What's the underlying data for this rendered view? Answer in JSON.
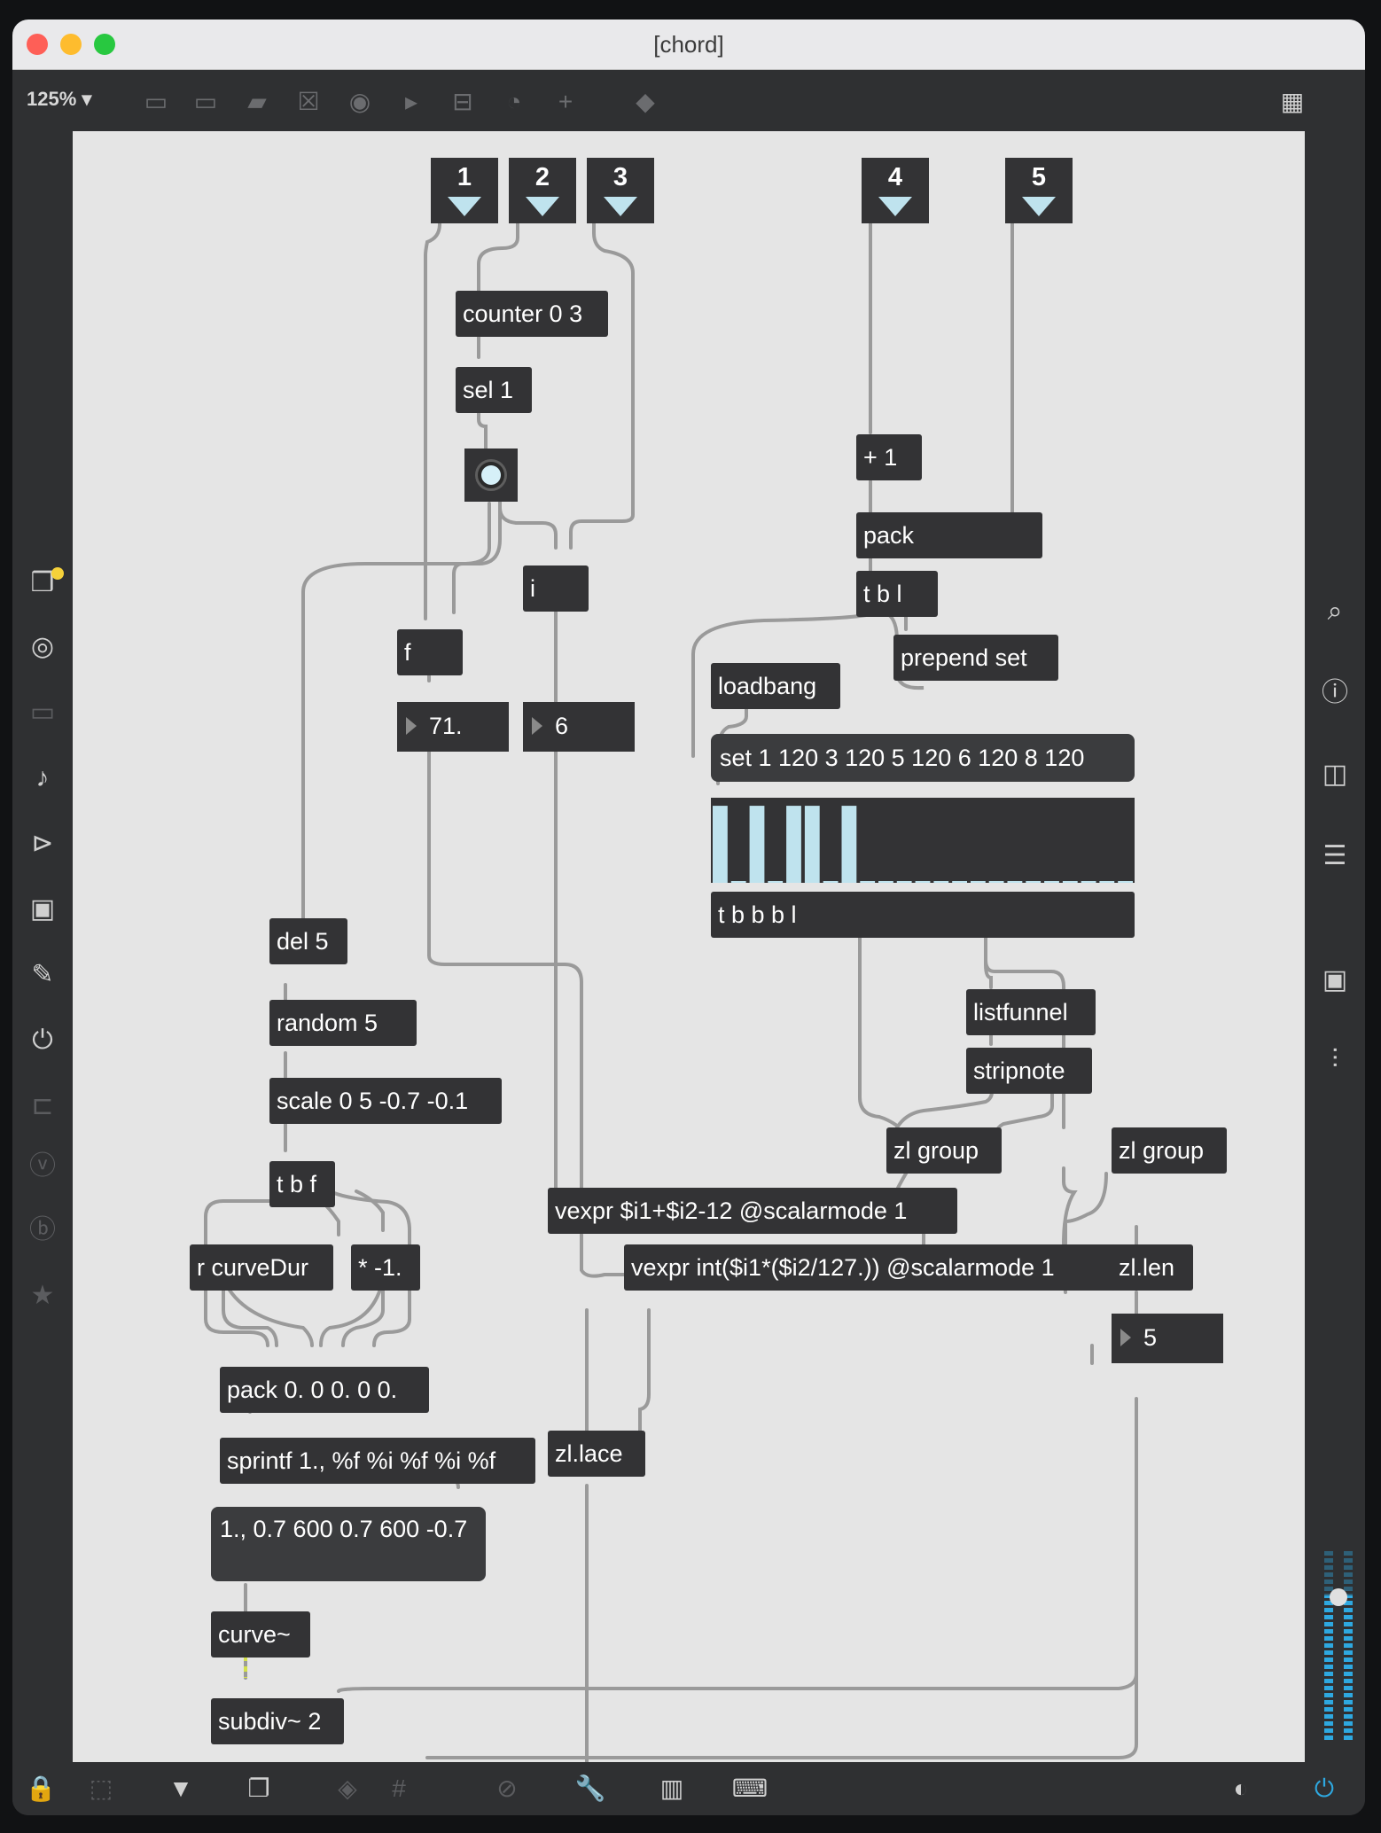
{
  "window": {
    "title": "[chord]"
  },
  "toolbar": {
    "zoom": "125% ▾"
  },
  "inlets": [
    {
      "label": "1"
    },
    {
      "label": "2"
    },
    {
      "label": "3"
    },
    {
      "label": "4"
    },
    {
      "label": "5"
    }
  ],
  "objects": {
    "counter": "counter 0 3",
    "sel": "sel 1",
    "plus": "+ 1",
    "pack": "pack",
    "tbl": "t b l",
    "prepend": "prepend set",
    "loadbang": "loadbang",
    "i": "i",
    "f": "f",
    "del": "del 5",
    "random": "random 5",
    "scale": "scale 0 5 -0.7 -0.1",
    "tbf": "t b f",
    "curveDur": "r curveDur",
    "mul": "* -1.",
    "pack2": "pack 0. 0 0. 0 0.",
    "sprintf": "sprintf 1., %f %i %f %i %f",
    "curve": "curve~",
    "subdiv": "subdiv~ 2",
    "tbbbl": "t b b b l",
    "listfunnel": "listfunnel",
    "stripnote": "stripnote",
    "zlgroup1": "zl group",
    "zlgroup2": "zl group",
    "vexpr1": "vexpr $i1+$i2-12 @scalarmode 1",
    "vexpr2": "vexpr int($i1*($i2/127.)) @scalarmode 1",
    "zllen": "zl.len",
    "zllace": "zl.lace"
  },
  "messages": {
    "set": "set 1 120 3 120 5 120 6 120 8 120",
    "curveMsg": "1., 0.7 600 0.7 600 -0.7"
  },
  "numbers": {
    "f_out": "71.",
    "i_out": "6",
    "len_out": "5"
  },
  "multislider": {
    "values": [
      120,
      0,
      120,
      0,
      120,
      120,
      0,
      120,
      0,
      0,
      0,
      0,
      0,
      0,
      0,
      0,
      0,
      0,
      0,
      0,
      0,
      0,
      0
    ],
    "max": 127
  },
  "colors": {
    "accent": "#bfe3ee",
    "object": "#333335",
    "canvas": "#e5e5e5",
    "power": "#2ea8e0"
  },
  "left_icons": [
    "package-icon",
    "target-icon",
    "device-icon",
    "music-note-icon",
    "media-icon",
    "image-icon",
    "paperclip-icon",
    "plug-icon",
    "connector-icon",
    "vst-icon",
    "beap-icon",
    "star-icon"
  ],
  "right_icons": [
    "search-icon",
    "info-icon",
    "columns-icon",
    "list-icon",
    "camera-icon",
    "mixer-icon"
  ]
}
